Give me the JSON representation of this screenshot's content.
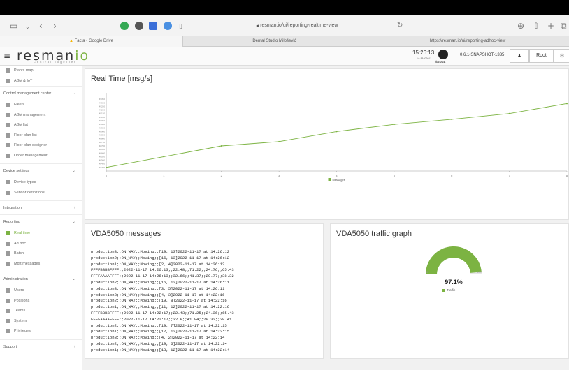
{
  "browser": {
    "url": "resman.io/ui/reporting-realtime-view",
    "tabs": [
      "Facta - Google Drive",
      "Dental Studio Milošević",
      "https://resman.io/ui/reporting-adhoc-view"
    ]
  },
  "header": {
    "logo_text": "resman",
    "logo_accent": "io",
    "tagline": "Central Together",
    "time": "15:26:13",
    "date": "17.11.2022",
    "brand": "ŠKODA",
    "version": "0.6.1-SNAPSHOT-1335",
    "user_label": "Root"
  },
  "sidebar": {
    "top_items": [
      {
        "label": "Plants map",
        "icon": "map-icon"
      },
      {
        "label": "AGV & IoT",
        "icon": "gear-icon"
      }
    ],
    "sections": [
      {
        "title": "Control management center",
        "items": [
          {
            "label": "Fleets",
            "icon": "fleet-icon"
          },
          {
            "label": "AGV management",
            "icon": "car-icon"
          },
          {
            "label": "AGV list",
            "icon": "car-icon"
          },
          {
            "label": "Floor plan list",
            "icon": "list-icon"
          },
          {
            "label": "Floor plan designer",
            "icon": "floorplan-icon"
          },
          {
            "label": "Order management",
            "icon": "order-icon"
          }
        ]
      },
      {
        "title": "Device settings",
        "items": [
          {
            "label": "Device types",
            "icon": "device-icon"
          },
          {
            "label": "Sensor definitions",
            "icon": "sensor-icon"
          }
        ]
      },
      {
        "title": "Integration",
        "items": []
      },
      {
        "title": "Reporting",
        "items": [
          {
            "label": "Real time",
            "icon": "chart-icon",
            "active": true
          },
          {
            "label": "Ad hoc",
            "icon": "chart-icon"
          },
          {
            "label": "Batch",
            "icon": "chart-icon"
          },
          {
            "label": "Mqtt messages",
            "icon": "message-icon"
          }
        ]
      },
      {
        "title": "Administration",
        "items": [
          {
            "label": "Users",
            "icon": "users-icon"
          },
          {
            "label": "Positions",
            "icon": "users-icon"
          },
          {
            "label": "Teams",
            "icon": "users-icon"
          },
          {
            "label": "System",
            "icon": "users-icon"
          },
          {
            "label": "Privileges",
            "icon": "users-icon"
          }
        ]
      },
      {
        "title": "Support",
        "items": []
      }
    ]
  },
  "realtime": {
    "title": "Real Time [msg/s]",
    "legend": "Messages",
    "color": "#7cb342"
  },
  "chart_data": {
    "type": "line",
    "title": "Real Time [msg/s]",
    "x": [
      0,
      1,
      2,
      3,
      4,
      5,
      6,
      7,
      8
    ],
    "series": [
      {
        "name": "Messages",
        "values": [
          48400,
          48550,
          48700,
          48760,
          48900,
          49000,
          49070,
          49150,
          49290
        ]
      }
    ],
    "ylim": [
      48350,
      49400
    ],
    "yticks": [
      "48400",
      "48450",
      "48500",
      "48550",
      "48600",
      "48650",
      "48700",
      "48750",
      "48800",
      "48850",
      "48900",
      "48950",
      "49000",
      "49050",
      "49100",
      "49150",
      "49200",
      "49250",
      "49300",
      "49350"
    ],
    "xlim": [
      0,
      8
    ]
  },
  "vda": {
    "title": "VDA5050 messages",
    "lines": [
      "production3;;ON_WAY;;Moving;;[19, 13]2022-11-17 at 14:26:12",
      "production2;;ON_WAY;;Moving;;[16, 13]2022-11-17 at 14:26:12",
      "production1;;ON_WAY;;Moving;;[2, 4]2022-11-17 at 14:26:12",
      "FFFFBBBBFFFF;;2022-11-17 14:26:13;;22.48;;71.22;;24.76;;65.43",
      "FFFFAAAAFFFF;;2022-11-17 14:26:13;;32.66;;41.37;;29.77;;38.32",
      "production2;;ON_WAY;;Moving;;[16, 12]2022-11-17 at 14:26:11",
      "production3;;ON_WAY;;Moving;;[3, 5]2022-11-17 at 14:26:11",
      "production3;;ON_WAY;;Moving;;[4, 3]2022-11-17 at 14:22:16",
      "production2;;ON_WAY;;Moving;;[19, 8]2022-11-17 at 14:22:16",
      "production1;;ON_WAY;;Moving;;[11, 12]2022-11-17 at 14:22:16",
      "FFFFBBBBFFFF;;2022-11-17 14:22:17;;22.43;;71.25;;24.36;;65.43",
      "FFFFAAAAFFFF;;2022-11-17 14:22:17;;32.8;;41.94;;29.32;;38.41",
      "production2;;ON_WAY;;Moving;;[19, 7]2022-11-17 at 14:22:15",
      "production1;;ON_WAY;;Moving;;[12, 12]2022-11-17 at 14:22:15",
      "production3;;ON_WAY;;Moving;;[4, 2]2022-11-17 at 14:22:14",
      "production2;;ON_WAY;;Moving;;[19, 6]2022-11-17 at 14:22:14",
      "production1;;ON_WAY;;Moving;;[13, 12]2022-11-17 at 14:22:14"
    ]
  },
  "traffic": {
    "title": "VDA5050 traffic graph",
    "value": 97.1,
    "value_label": "97.1%",
    "min_label": "0",
    "max_label": "100",
    "legend": "Traffic",
    "color": "#7cb342",
    "track_color": "#e6e6e6"
  }
}
